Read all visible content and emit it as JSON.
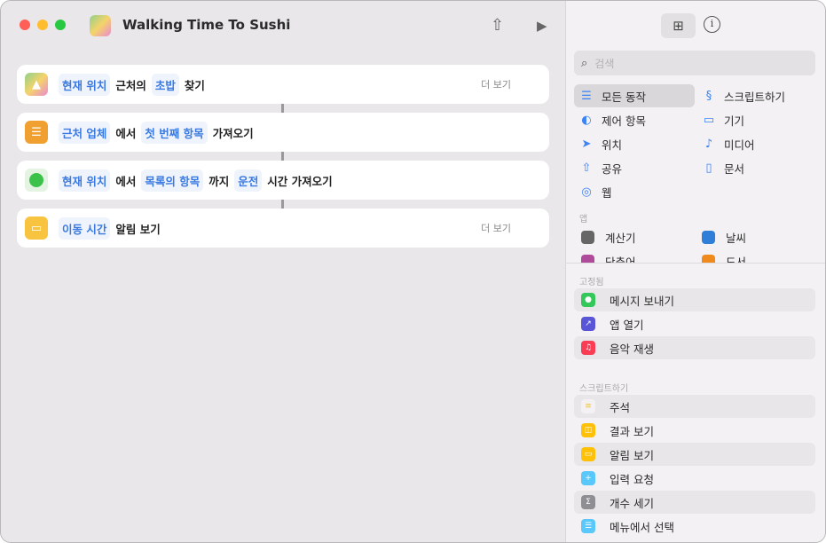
{
  "window": {
    "title": "Walking Time To Sushi"
  },
  "toolbar": {
    "share_icon": "share-icon",
    "run_icon": "play-icon"
  },
  "actions": [
    {
      "icon": "maps-icon",
      "parts": [
        {
          "t": "token",
          "v": "현재 위치"
        },
        {
          "t": "text",
          "v": "근처의"
        },
        {
          "t": "token",
          "v": "초밥"
        },
        {
          "t": "text",
          "v": "찾기"
        }
      ],
      "more": "더 보기"
    },
    {
      "icon": "list-icon",
      "parts": [
        {
          "t": "token",
          "v": "근처 업체"
        },
        {
          "t": "text",
          "v": "에서"
        },
        {
          "t": "token",
          "v": "첫 번째 항목"
        },
        {
          "t": "text",
          "v": "가져오기"
        }
      ]
    },
    {
      "icon": "clock-icon",
      "parts": [
        {
          "t": "token",
          "v": "현재 위치"
        },
        {
          "t": "text",
          "v": "에서"
        },
        {
          "t": "token",
          "v": "목록의 항목"
        },
        {
          "t": "text",
          "v": "까지"
        },
        {
          "t": "token",
          "v": "운전"
        },
        {
          "t": "text",
          "v": "시간 가져오기"
        }
      ]
    },
    {
      "icon": "alert-icon",
      "parts": [
        {
          "t": "token",
          "v": "이동 시간"
        },
        {
          "t": "text",
          "v": "알림 보기"
        }
      ],
      "more": "더 보기"
    }
  ],
  "sidebar": {
    "search_placeholder": "검색",
    "categories": [
      {
        "label": "모든 동작",
        "icon": "☰"
      },
      {
        "label": "스크립트하기",
        "icon": "§"
      },
      {
        "label": "제어 항목",
        "icon": "◐"
      },
      {
        "label": "기기",
        "icon": "▭"
      },
      {
        "label": "위치",
        "icon": "➤"
      },
      {
        "label": "미디어",
        "icon": "♪"
      },
      {
        "label": "공유",
        "icon": "⇧"
      },
      {
        "label": "문서",
        "icon": "▯"
      },
      {
        "label": "웹",
        "icon": "◎"
      }
    ],
    "apps_header": "앱",
    "apps": [
      {
        "label": "계산기",
        "color": "#666"
      },
      {
        "label": "날씨",
        "color": "#2f7fd8"
      },
      {
        "label": "단축어",
        "color": "#b04a9a"
      },
      {
        "label": "도서",
        "color": "#f08a1c"
      }
    ],
    "pinned_header": "고정됨",
    "pinned": [
      {
        "label": "메시지 보내기",
        "color": "#34c759",
        "glyph": "●"
      },
      {
        "label": "앱 열기",
        "color": "#5856d6",
        "glyph": "↗"
      },
      {
        "label": "음악 재생",
        "color": "#fa3c55",
        "glyph": "♫"
      }
    ],
    "scripting_header": "스크립트하기",
    "scripting": [
      {
        "label": "주석",
        "color": "#f3f1f3",
        "glyph": "≡"
      },
      {
        "label": "결과 보기",
        "color": "#ffc107",
        "glyph": "◫"
      },
      {
        "label": "알림 보기",
        "color": "#ffc107",
        "glyph": "▭"
      },
      {
        "label": "입력 요청",
        "color": "#5ac8fa",
        "glyph": "+"
      },
      {
        "label": "개수 세기",
        "color": "#8e8e93",
        "glyph": "Σ"
      },
      {
        "label": "메뉴에서 선택",
        "color": "#5ac8fa",
        "glyph": "☰"
      }
    ]
  }
}
